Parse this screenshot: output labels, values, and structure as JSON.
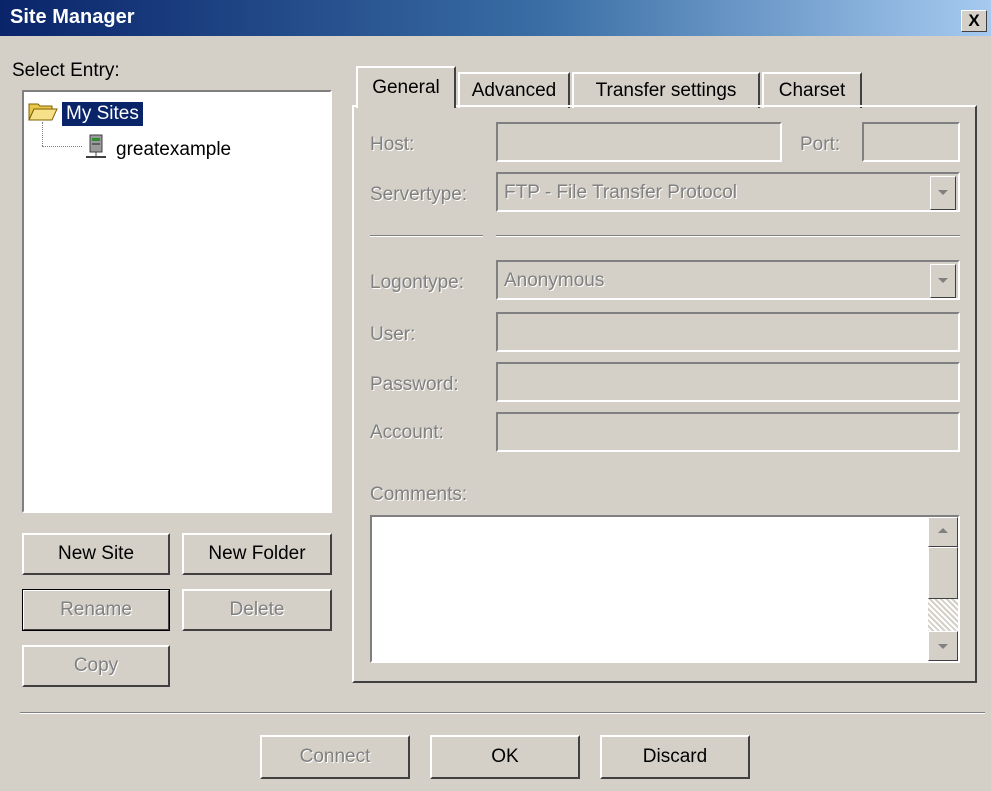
{
  "window": {
    "title": "Site Manager",
    "close_label": "X"
  },
  "select_entry_label": "Select Entry:",
  "tree": {
    "folder": {
      "label": "My Sites",
      "icon": "folder-open-icon"
    },
    "children": [
      {
        "label": "greatexample",
        "icon": "server-icon"
      }
    ]
  },
  "left_buttons": {
    "new_site": "New Site",
    "new_folder": "New Folder",
    "rename": "Rename",
    "delete": "Delete",
    "copy": "Copy"
  },
  "tabs": [
    {
      "label": "General",
      "active": true
    },
    {
      "label": "Advanced"
    },
    {
      "label": "Transfer settings"
    },
    {
      "label": "Charset"
    }
  ],
  "general": {
    "host_label": "Host:",
    "host_value": "",
    "port_label": "Port:",
    "port_value": "",
    "servertype_label": "Servertype:",
    "servertype_value": "FTP - File Transfer Protocol",
    "logontype_label": "Logontype:",
    "logontype_value": "Anonymous",
    "user_label": "User:",
    "password_label": "Password:",
    "account_label": "Account:",
    "comments_label": "Comments:"
  },
  "footer": {
    "connect": "Connect",
    "ok": "OK",
    "discard": "Discard"
  },
  "colors": {
    "title_bar_start": "#0a246a",
    "selection": "#0a246a",
    "window_bg": "#d4d0c8"
  }
}
